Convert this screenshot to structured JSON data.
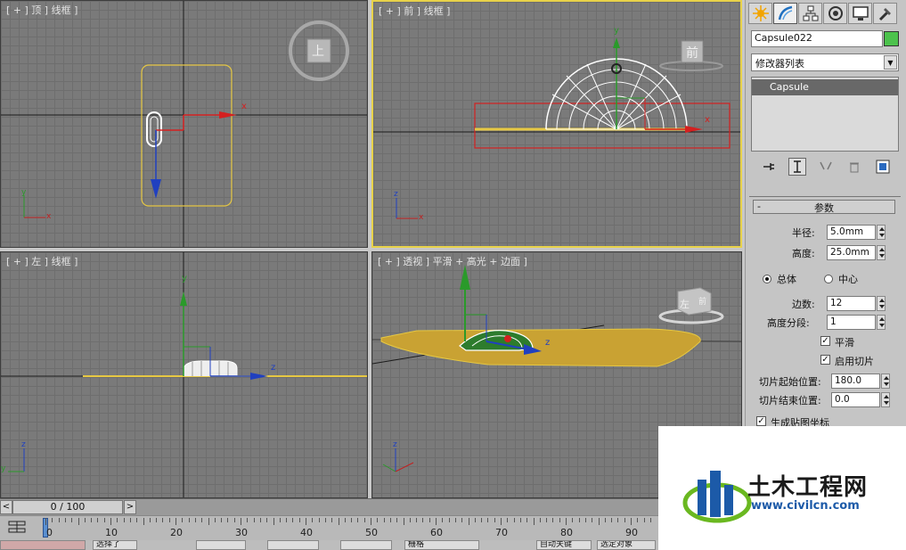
{
  "viewports": {
    "top": {
      "label": "[ + ] 顶 ] 线框 ]",
      "cube_label": "上",
      "axis_x": "x"
    },
    "front": {
      "label": "[ + ] 前 ] 线框 ]",
      "cube_label": "前",
      "axis_y": "y",
      "axis_x": "x"
    },
    "left": {
      "label": "[ + ] 左 ] 线框 ]",
      "axis_y": "y",
      "axis_z": "z"
    },
    "perspective": {
      "label": "[ + ] 透视 ] 平滑 + 高光 + 边面 ]",
      "cube_label": "左",
      "cube_label2": "前",
      "axis_z": "z"
    },
    "mini_axes": {
      "z": "z",
      "y": "y",
      "x": "x"
    }
  },
  "command_panel": {
    "tabs": [
      "create-icon",
      "modify-icon",
      "hierarchy-icon",
      "motion-icon",
      "display-icon",
      "utilities-icon"
    ],
    "object_name": "Capsule022",
    "object_color": "#4cc24c",
    "modifier_list": "修改器列表",
    "stack_item": "Capsule",
    "params": {
      "title": "参数",
      "collapse": "-",
      "radius_label": "半径:",
      "radius_value": "5.0mm",
      "height_label": "高度:",
      "height_value": "25.0mm",
      "overall_label": "总体",
      "center_label": "中心",
      "sides_label": "边数:",
      "sides_value": "12",
      "height_segs_label": "高度分段:",
      "height_segs_value": "1",
      "smooth_label": "平滑",
      "slice_on_label": "启用切片",
      "slice_from_label": "切片起始位置:",
      "slice_from_value": "180.0",
      "slice_to_label": "切片结束位置:",
      "slice_to_value": "0.0",
      "gen_map_label": "生成贴图坐标"
    }
  },
  "timeline": {
    "prev": "<",
    "next": ">",
    "frame": "0 / 100",
    "ticks": [
      "0",
      "10",
      "20",
      "30",
      "40",
      "50",
      "60",
      "70",
      "80",
      "90"
    ]
  },
  "status_bar": {
    "select_label": "选择了",
    "grid_label": "栅格",
    "auto_key": "自动关键",
    "selected_obj": "选定对象"
  },
  "watermark": {
    "name": "土木工程网",
    "url": "www.civilcn.com"
  }
}
